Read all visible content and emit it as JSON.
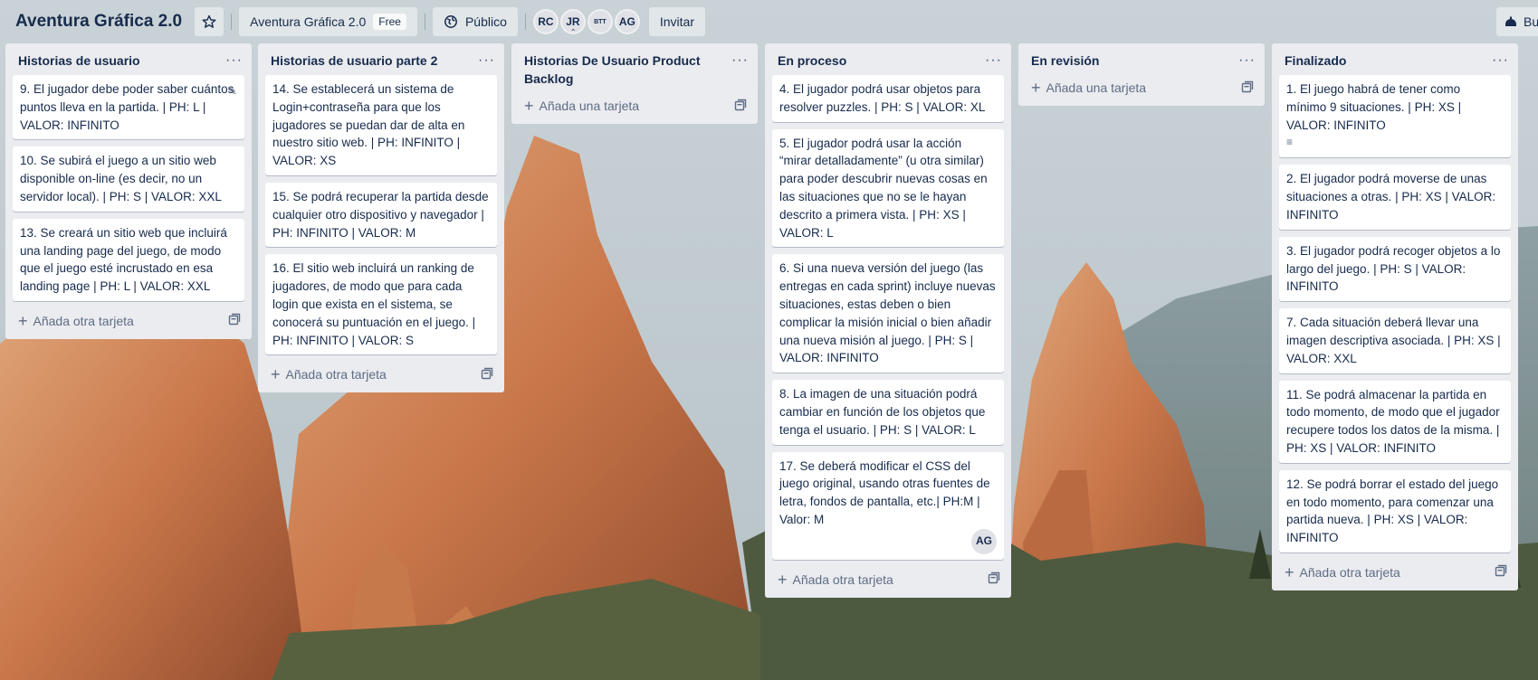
{
  "header": {
    "board_title": "Aventura Gráfica 2.0",
    "star_icon": "star-icon",
    "workspace_label": "Aventura Gráfica 2.0",
    "workspace_plan": "Free",
    "visibility_label": "Público",
    "members": [
      "RC",
      "JR",
      "BTT",
      "AG"
    ],
    "invite_label": "Invitar",
    "butler_label": "Bu"
  },
  "lists": [
    {
      "title": "Historias de usuario",
      "cards": [
        {
          "text": "9. El jugador debe poder saber cuántos puntos lleva en la partida. | PH: L | VALOR: INFINITO"
        },
        {
          "text": "10. Se subirá el juego a un sitio web disponible on-line (es decir, no un servidor local). | PH: S | VALOR: XXL"
        },
        {
          "text": "13. Se creará un sitio web que incluirá una landing page del juego, de modo que el juego esté incrustado en esa landing page | PH: L | VALOR: XXL"
        }
      ],
      "add_label": "Añada otra tarjeta"
    },
    {
      "title": "Historias de usuario parte 2",
      "cards": [
        {
          "text": "14. Se establecerá un sistema de Login+contraseña para que los jugadores se puedan dar de alta en nuestro sitio web. | PH: INFINITO | VALOR: XS"
        },
        {
          "text": "15. Se podrá recuperar la partida desde cualquier otro dispositivo y navegador | PH: INFINITO | VALOR: M"
        },
        {
          "text": "16. El sitio web incluirá un ranking de jugadores, de modo que para cada login que exista en el sistema, se conocerá su puntuación en el juego. | PH: INFINITO | VALOR: S"
        }
      ],
      "add_label": "Añada otra tarjeta"
    },
    {
      "title": "Historias De Usuario Product Backlog",
      "cards": [],
      "add_label": "Añada una tarjeta"
    },
    {
      "title": "En proceso",
      "cards": [
        {
          "text": "4. El jugador podrá usar objetos para resolver puzzles. | PH: S | VALOR: XL"
        },
        {
          "text": "5. El jugador podrá usar la acción “mirar detalladamente” (u otra similar) para poder descubrir nuevas cosas en las situaciones que no se le hayan descrito a primera vista. | PH: XS | VALOR: L"
        },
        {
          "text": "6. Si una nueva versión del juego (las entregas en cada sprint) incluye nuevas situaciones, estas deben o bien complicar la misión inicial o bien añadir una nueva misión al juego. | PH: S | VALOR: INFINITO"
        },
        {
          "text": "8. La imagen de una situación podrá cambiar en función de los objetos que tenga el usuario. | PH: S | VALOR: L"
        },
        {
          "text": "17. Se deberá modificar el CSS del juego original, usando otras fuentes de letra, fondos de pantalla, etc.| PH:M | Valor: M",
          "member": "AG"
        }
      ],
      "add_label": "Añada otra tarjeta"
    },
    {
      "title": "En revisión",
      "cards": [],
      "add_label": "Añada una tarjeta"
    },
    {
      "title": "Finalizado",
      "cards": [
        {
          "text": "1. El juego habrá de tener como mínimo 9 situaciones. | PH: XS | VALOR: INFINITO",
          "has_description": true
        },
        {
          "text": "2. El jugador podrá moverse de unas situaciones a otras. | PH: XS | VALOR: INFINITO"
        },
        {
          "text": "3. El jugador podrá recoger objetos a lo largo del juego. | PH: S | VALOR: INFINITO"
        },
        {
          "text": "7. Cada situación deberá llevar una imagen descriptiva asociada. | PH: XS | VALOR: XXL"
        },
        {
          "text": "11. Se podrá almacenar la partida en todo momento, de modo que el jugador recupere todos los datos de la misma. | PH: XS | VALOR: INFINITO"
        },
        {
          "text": "12. Se podrá borrar el estado del juego en todo momento, para comenzar una partida nueva. | PH: XS | VALOR: INFINITO"
        }
      ],
      "add_label": "Añada otra tarjeta"
    }
  ],
  "colors": {
    "list_bg": "#ebecf0",
    "card_bg": "#ffffff",
    "text": "#172b4d",
    "muted": "#5e6c84"
  }
}
